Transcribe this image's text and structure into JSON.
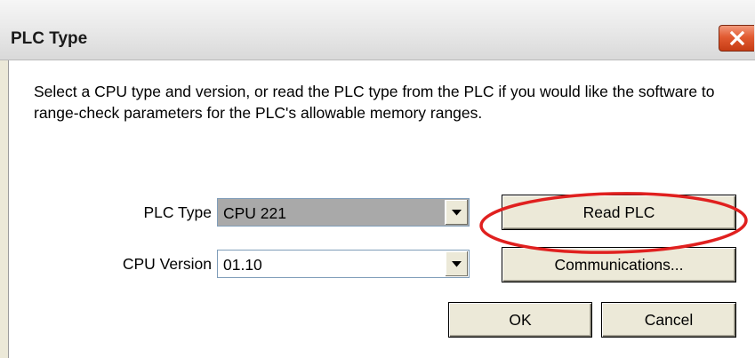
{
  "window": {
    "title": "PLC Type"
  },
  "dialog": {
    "description": "Select a CPU type and version, or read the PLC type from the PLC if you would like the software to range-check parameters for the PLC's allowable memory ranges.",
    "plc_type": {
      "label": "PLC Type",
      "value": "CPU 221",
      "enabled": false
    },
    "cpu_version": {
      "label": "CPU Version",
      "value": "01.10",
      "enabled": true
    },
    "buttons": {
      "read_plc": "Read PLC",
      "communications": "Communications...",
      "ok": "OK",
      "cancel": "Cancel"
    }
  },
  "icons": {
    "close": "close-icon",
    "dropdown": "chevron-down-icon"
  },
  "colors": {
    "highlight_ellipse": "#e0201f",
    "close_button": "#e25b32",
    "dialog_background": "#ece9d8",
    "disabled_field": "#a9a9a9"
  }
}
